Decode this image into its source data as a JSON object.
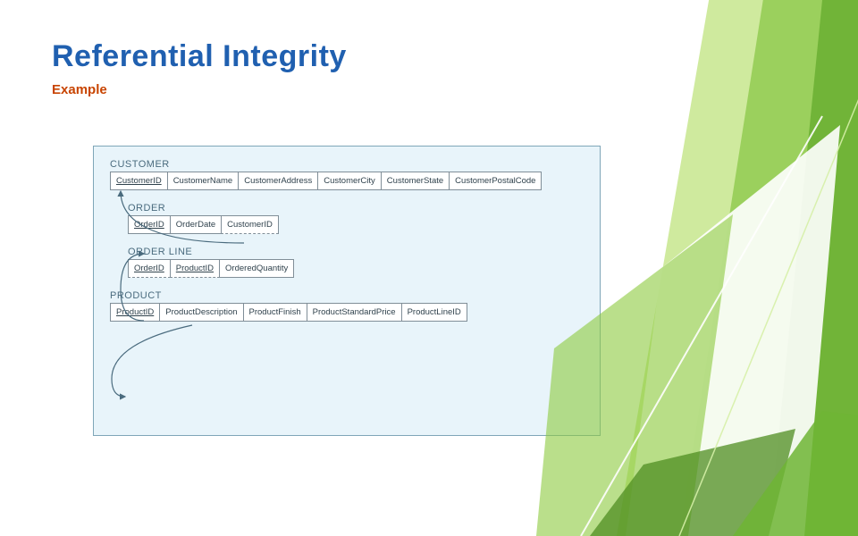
{
  "title": "Referential Integrity",
  "subtitle": "Example",
  "tables": {
    "customer": {
      "label": "CUSTOMER",
      "cols": [
        "CustomerID",
        "CustomerName",
        "CustomerAddress",
        "CustomerCity",
        "CustomerState",
        "CustomerPostalCode"
      ]
    },
    "order": {
      "label": "ORDER",
      "cols": [
        "OrderID",
        "OrderDate",
        "CustomerID"
      ]
    },
    "orderline": {
      "label": "ORDER LINE",
      "cols": [
        "OrderID",
        "ProductID",
        "OrderedQuantity"
      ]
    },
    "product": {
      "label": "PRODUCT",
      "cols": [
        "ProductID",
        "ProductDescription",
        "ProductFinish",
        "ProductStandardPrice",
        "ProductLineID"
      ]
    }
  }
}
